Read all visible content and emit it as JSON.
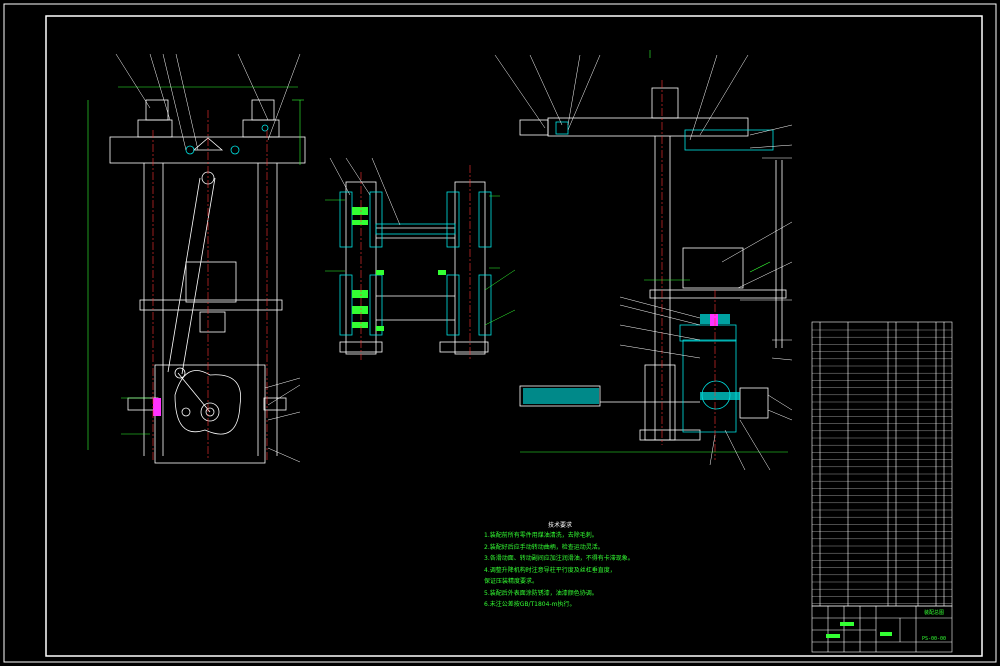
{
  "title_block": {
    "drawing_number": "PS-00-00",
    "drawing_name": "装配总图",
    "company": "",
    "material_label": ""
  },
  "tech_requirements": {
    "title": "技术要求",
    "lines": [
      "1.装配前所有零件用煤油清洗，去除毛刺。",
      "2.装配好后应手动转动曲柄，检查运动灵活。",
      "3.各滑动面、转动副间应加注润滑油，不得有卡滞现象。",
      "4.调整升降机构时注意导柱平行度及丝杠垂直度，",
      "  保证压装精度要求。",
      "5.装配后外表面涂防锈漆，油漆颜色协调。",
      "6.未注公差按GB/T1804-m执行。"
    ]
  },
  "colors": {
    "line": "#ffffff",
    "hatch": "#00e5e5",
    "leader": "#33ff33",
    "centerline": "#ff3333",
    "highlight": "#ff33ff",
    "frame": "#ffffff"
  }
}
